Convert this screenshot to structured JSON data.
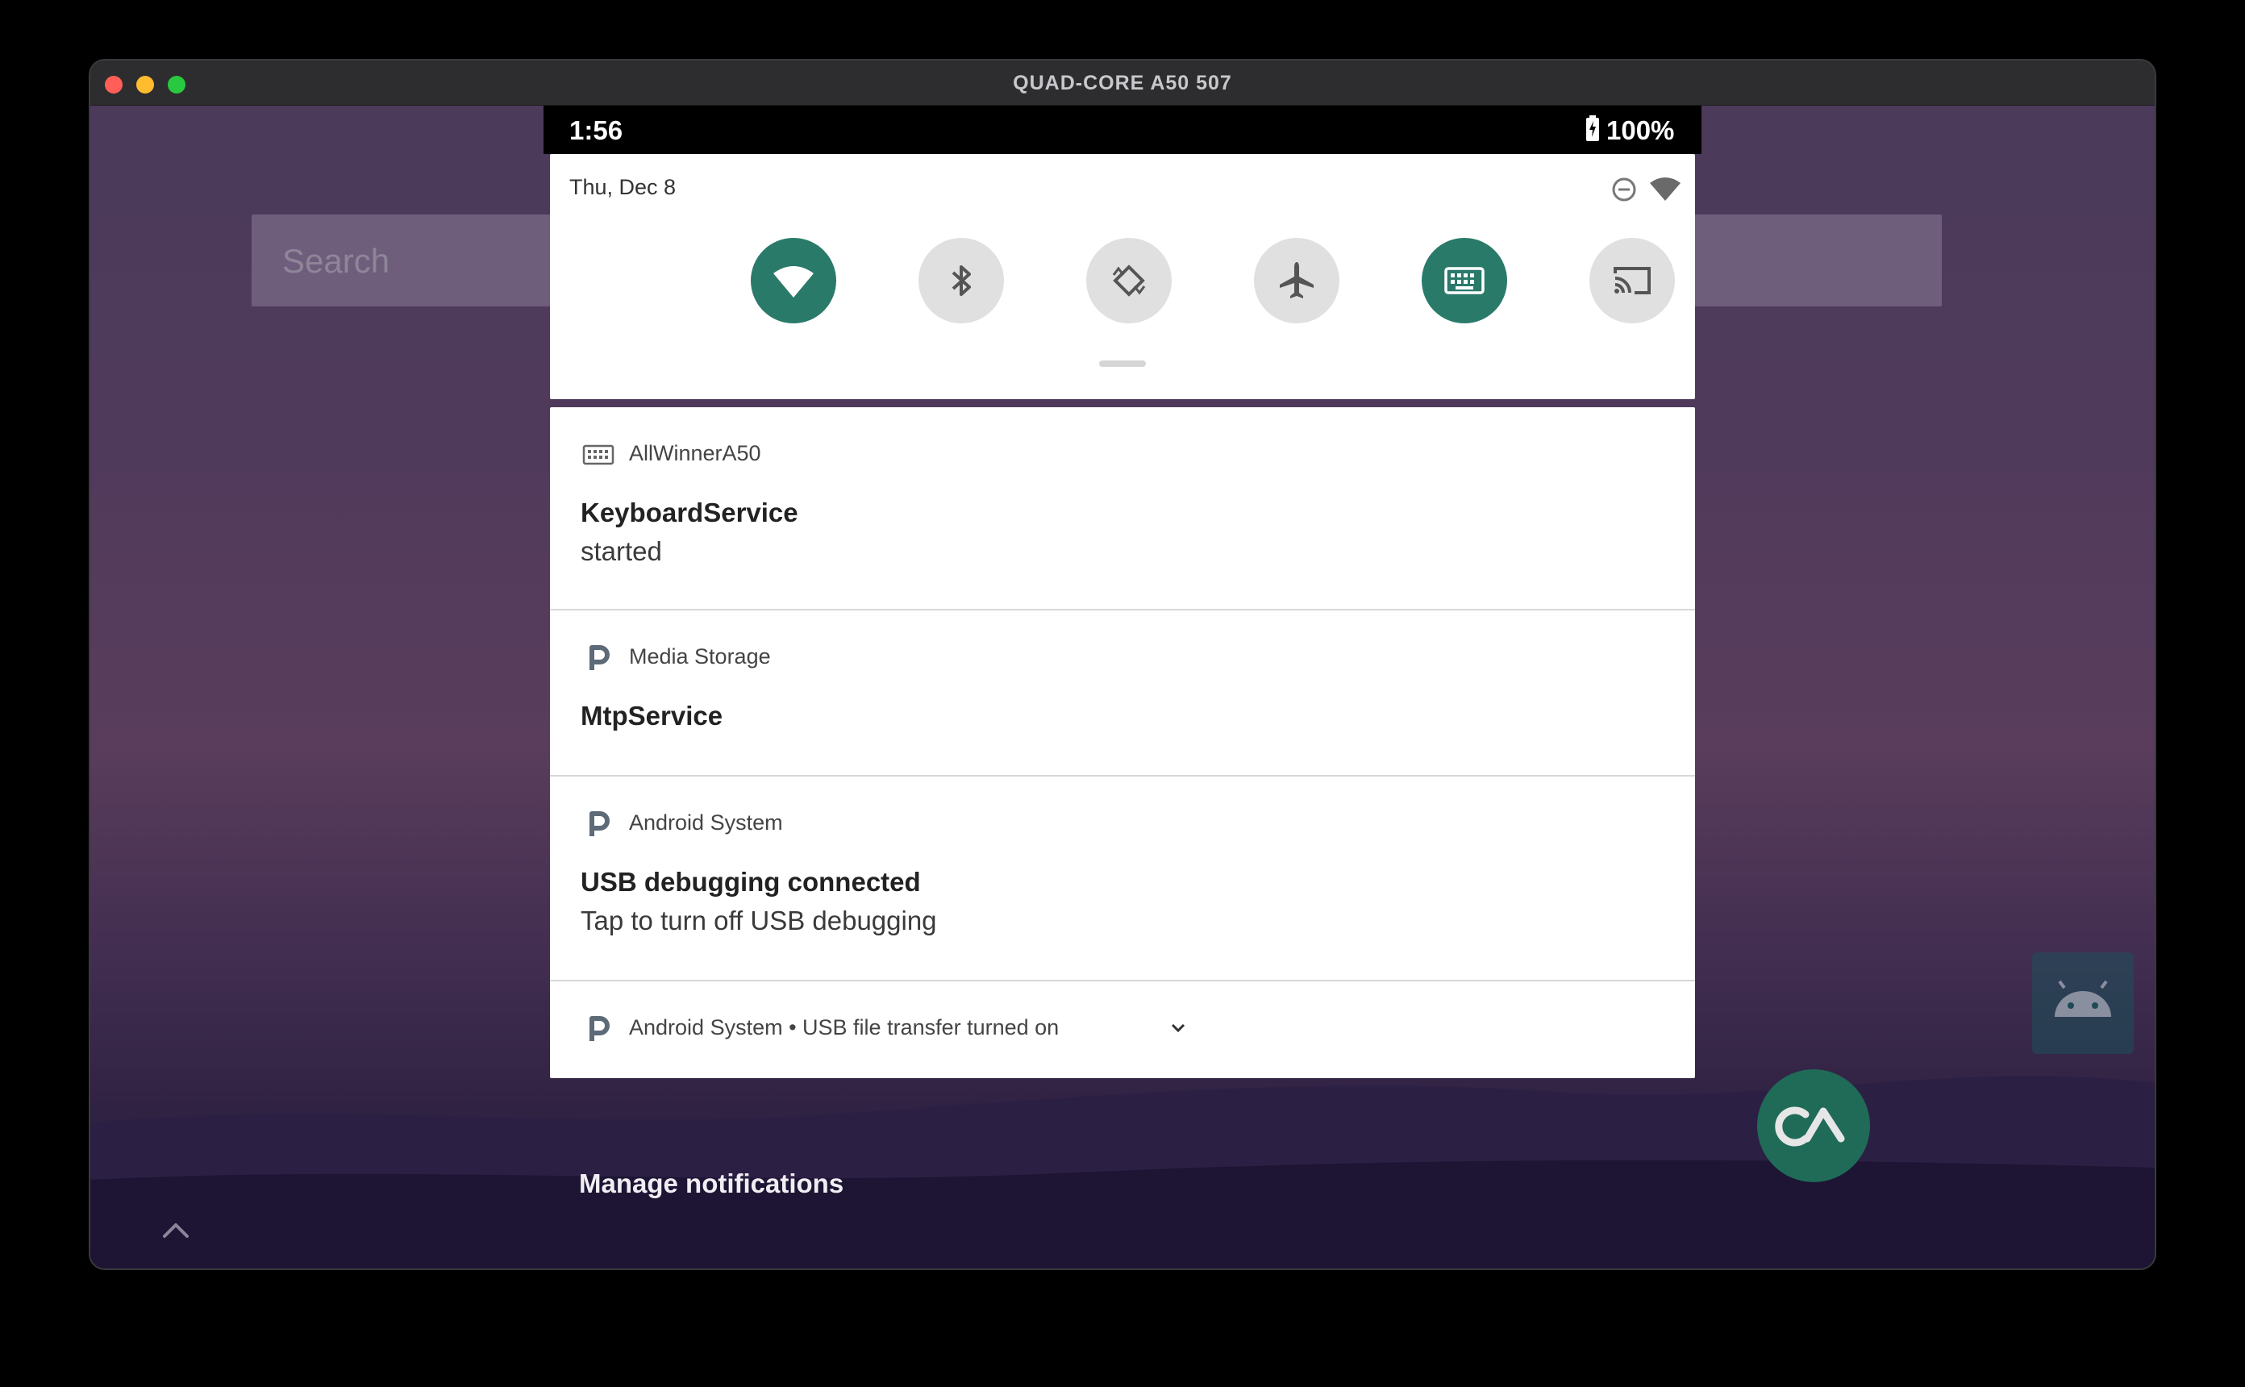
{
  "window": {
    "title": "QUAD-CORE A50 507"
  },
  "statusbar": {
    "time": "1:56",
    "battery": "100%"
  },
  "home": {
    "search_placeholder": "Search"
  },
  "quick_settings": {
    "date": "Thu, Dec 8",
    "tiles": [
      {
        "name": "wifi",
        "state": "on"
      },
      {
        "name": "bluetooth",
        "state": "off"
      },
      {
        "name": "auto-rotate",
        "state": "off"
      },
      {
        "name": "airplane-mode",
        "state": "off"
      },
      {
        "name": "keyboard",
        "state": "on"
      },
      {
        "name": "cast",
        "state": "off"
      }
    ]
  },
  "notifications": [
    {
      "app": "AllWinnerA50",
      "icon": "keyboard-icon",
      "title": "KeyboardService",
      "text": "started"
    },
    {
      "app": "Media Storage",
      "icon": "p-icon",
      "title": "MtpService",
      "text": ""
    },
    {
      "app": "Android System",
      "icon": "p-icon",
      "title": "USB debugging connected",
      "text": "Tap to turn off USB debugging"
    },
    {
      "app": "Android System • USB file transfer turned on",
      "icon": "p-icon",
      "title": "",
      "text": ""
    }
  ],
  "manage_label": "Manage notifications",
  "colors": {
    "tile_on": "#2a7a6a",
    "tile_off": "#e0e0e0",
    "wallpaper_top": "#4b3a5a",
    "wallpaper_bottom": "#1e1635"
  }
}
